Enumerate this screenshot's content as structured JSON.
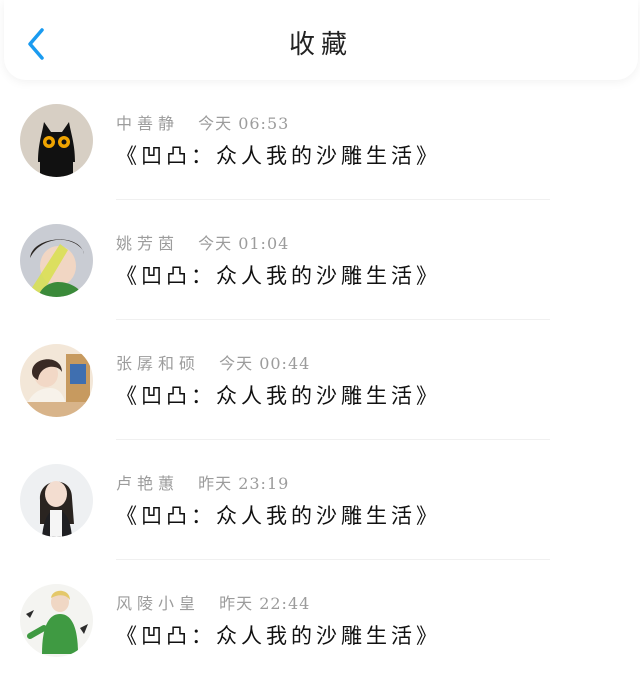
{
  "header": {
    "title": "收藏",
    "back_icon": "chevron-left-icon",
    "accent_color": "#1a9bf0"
  },
  "items": [
    {
      "name": "中善静",
      "time": "今天 06:53",
      "content": "《凹凸：众人我的沙雕生活》",
      "avatar": "black-cat-avatar"
    },
    {
      "name": "姚芳茵",
      "time": "今天 01:04",
      "content": "《凹凸：众人我的沙雕生活》",
      "avatar": "boy-photo-avatar"
    },
    {
      "name": "张孱和硕",
      "time": "今天 00:44",
      "content": "《凹凸：众人我的沙雕生活》",
      "avatar": "girl-desk-avatar"
    },
    {
      "name": "卢艳蕙",
      "time": "昨天 23:19",
      "content": "《凹凸：众人我的沙雕生活》",
      "avatar": "girl-portrait-avatar"
    },
    {
      "name": "风陵小皇",
      "time": "昨天 22:44",
      "content": "《凹凸：众人我的沙雕生活》",
      "avatar": "green-figure-avatar"
    }
  ]
}
